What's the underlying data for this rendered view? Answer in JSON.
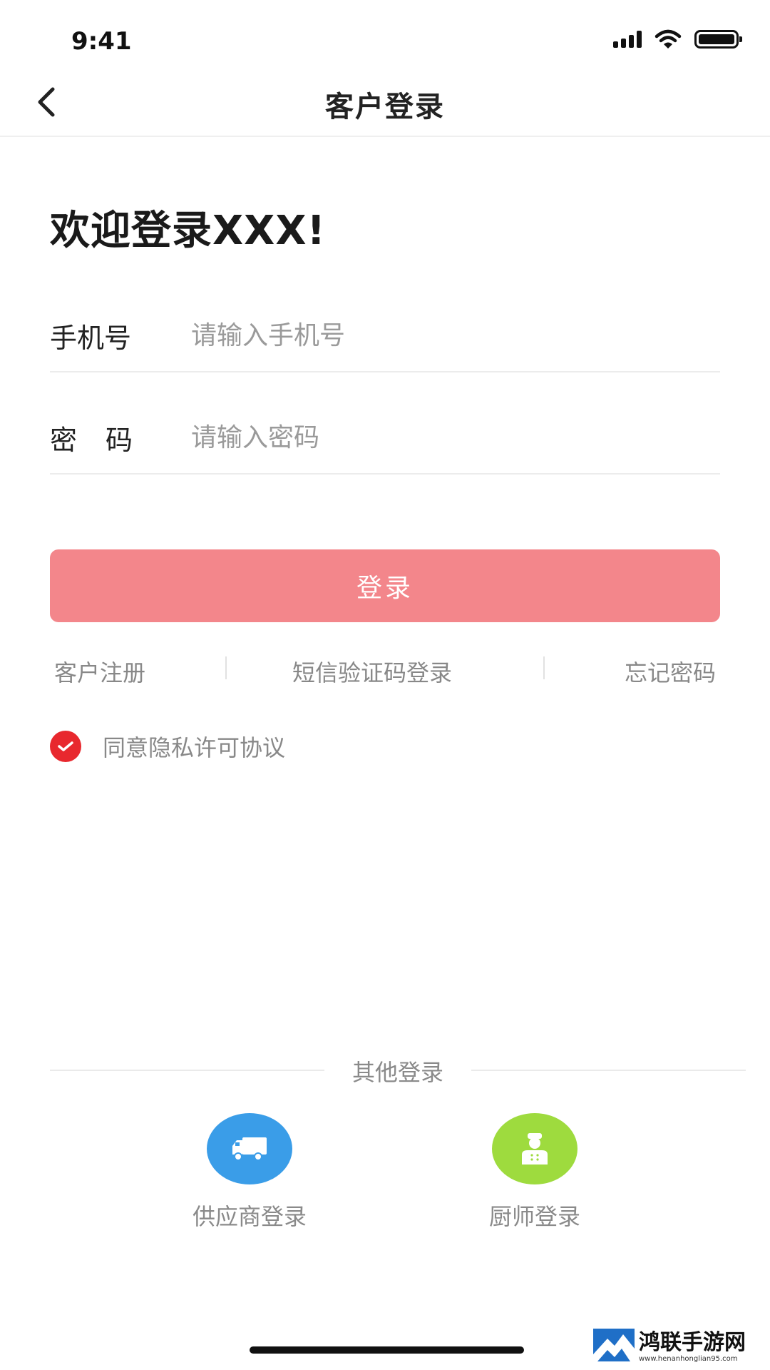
{
  "status_bar": {
    "time": "9:41"
  },
  "nav": {
    "title": "客户登录"
  },
  "welcome": "欢迎登录XXX!",
  "form": {
    "phone": {
      "label": "手机号",
      "placeholder": "请输入手机号"
    },
    "password": {
      "label": "密码",
      "placeholder": "请输入密码"
    },
    "login_label": "登录"
  },
  "links": {
    "register": "客户注册",
    "sms_login": "短信验证码登录",
    "forgot": "忘记密码"
  },
  "agreement": {
    "text": "同意隐私许可协议",
    "checked": true
  },
  "other": {
    "title": "其他登录",
    "supplier_label": "供应商登录",
    "chef_label": "厨师登录"
  },
  "watermark": {
    "title": "鸿联手游网",
    "url": "www.henanhonglian95.com"
  },
  "colors": {
    "accent": "#f3868b",
    "check": "#e8282e",
    "supplier": "#3a9de8",
    "chef": "#9edb3e"
  },
  "icons": {
    "back": "chevron-left-icon",
    "supplier": "truck-icon",
    "chef": "chef-icon",
    "check": "checkmark-icon"
  }
}
